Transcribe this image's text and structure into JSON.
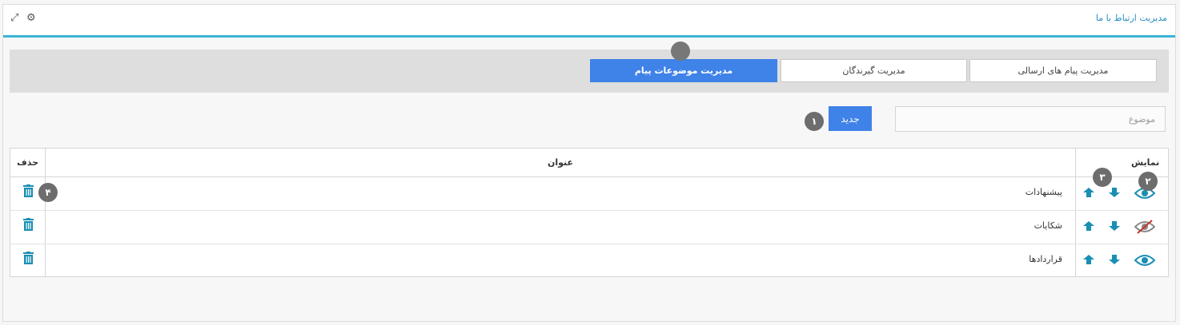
{
  "header": {
    "title": "مدیریت ارتباط با ما",
    "settings_icon": "gear-icon",
    "expand_icon": "expand-icon"
  },
  "tabs": [
    {
      "label": "مدیریت پیام های ارسالی",
      "active": false
    },
    {
      "label": "مدیریت گیرندگان",
      "active": false
    },
    {
      "label": "مدیریت موضوعات پیام",
      "active": true
    }
  ],
  "form": {
    "subject_placeholder": "موضوع",
    "subject_value": "",
    "new_button_label": "جدید"
  },
  "badges": {
    "b1": "۱",
    "b2": "۲",
    "b3": "۳",
    "b4": "۴"
  },
  "table": {
    "headers": {
      "show": "نمایش",
      "title": "عنوان",
      "delete": "حذف"
    },
    "rows": [
      {
        "title": "پیشنهادات",
        "visible": true
      },
      {
        "title": "شکایات",
        "visible": false
      },
      {
        "title": "قراردادها",
        "visible": true
      }
    ]
  },
  "colors": {
    "accent": "#3cb4d8",
    "primary_button": "#3f82e8",
    "icon_teal": "#1a8fb3",
    "hidden_slash": "#c9302c",
    "badge": "#6d6d6d"
  }
}
